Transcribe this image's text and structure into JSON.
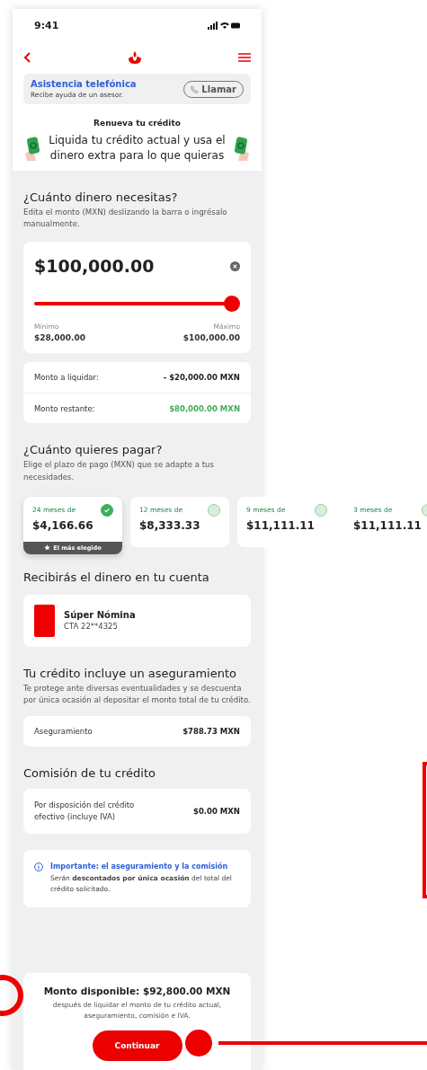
{
  "status_bar": {
    "time": "9:41"
  },
  "assistance": {
    "title": "Asistencia telefónica",
    "subtitle": "Recibe ayuda de un asesor.",
    "button": "Llamar"
  },
  "promo": {
    "title": "Renueva tu crédito",
    "text": "Liquida tu crédito actual y usa el dinero extra para lo que quieras"
  },
  "amount_section": {
    "heading": "¿Cuánto dinero necesitas?",
    "subtitle": "Edita el monto (MXN) deslizando la barra o ingrésalo manualmente.",
    "value": "$100,000.00",
    "level": 1,
    "min_label": "Mínimo",
    "min_value": "$28,000.00",
    "max_label": "Máximo",
    "max_value": "$100,000.00"
  },
  "summary": [
    {
      "label": "Monto a liquidar:",
      "value": "- $20,000.00 MXN",
      "kind": "debit"
    },
    {
      "label": "Monto restante:",
      "value": "$80,000.00 MXN",
      "kind": "credit"
    }
  ],
  "plans_section": {
    "heading": "¿Cuánto quieres pagar?",
    "subtitle": "Elige el plazo de pago (MXN) que se adapte a tus necesidades."
  },
  "plans": [
    {
      "term": "24 meses de",
      "amount": "$4,166.66",
      "selected": true,
      "badge": "El más elegido"
    },
    {
      "term": "12 meses de",
      "amount": "$8,333.33",
      "selected": false
    },
    {
      "term": "9 meses de",
      "amount": "$11,111.11",
      "selected": false
    },
    {
      "term": "3 meses de",
      "amount": "$11,111.11",
      "selected": false
    }
  ],
  "account_section": {
    "heading": "Recibirás el dinero en tu cuenta",
    "name": "Súper Nómina",
    "number": "CTA 22**4325"
  },
  "insurance_section": {
    "heading": "Tu crédito incluye un aseguramiento",
    "subtitle": "Te protege ante diversas eventualidades y se descuenta por única ocasión al depositar el monto total de tu crédito.",
    "label": "Aseguramiento",
    "value": "$788.73 MXN"
  },
  "commission_section": {
    "heading": "Comisión de tu crédito",
    "label": "Por disposición del crédito efectivo (incluye IVA)",
    "value": "$0.00 MXN"
  },
  "notice": {
    "title": "Importante: el aseguramiento y la comisión",
    "text": "Serán **descontados por única ocasión** del total del crédito solicitado."
  },
  "footer": {
    "title": "Monto disponible: $92,800.00 MXN",
    "text": "después de liquidar el monto de tu crédito actual, aseguramiento, comisión e IVA.",
    "button": "Continuar"
  }
}
